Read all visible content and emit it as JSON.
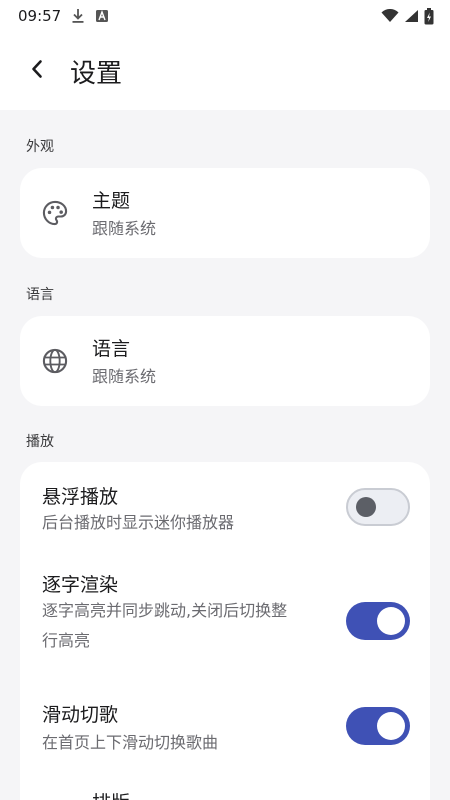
{
  "status_bar": {
    "time": "09:57"
  },
  "app_bar": {
    "title": "设置"
  },
  "sections": {
    "appearance": {
      "header": "外观",
      "theme": {
        "title": "主题",
        "subtitle": "跟随系统"
      }
    },
    "language": {
      "header": "语言",
      "language": {
        "title": "语言",
        "subtitle": "跟随系统"
      }
    },
    "playback": {
      "header": "播放",
      "floating_playback": {
        "title": "悬浮播放",
        "subtitle": "后台播放时显示迷你播放器",
        "enabled": false
      },
      "word_render": {
        "title": "逐字渲染",
        "subtitle_line1": "逐字高亮并同步跳动,关闭后切换整",
        "subtitle_line2": "行高亮",
        "enabled": true
      },
      "swipe_switch": {
        "title": "滑动切歌",
        "subtitle": "在首页上下滑动切换歌曲",
        "enabled": true
      },
      "layout": {
        "title": "排版"
      }
    }
  },
  "colors": {
    "accent": "#3f51b5",
    "background": "#f5f5f7",
    "card": "#ffffff"
  }
}
